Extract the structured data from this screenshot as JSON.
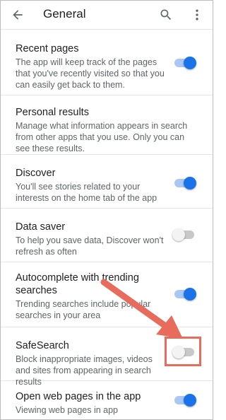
{
  "header": {
    "title": "General",
    "back_icon": "arrow-back-icon",
    "search_icon": "search-icon",
    "more_icon": "more-vert-icon"
  },
  "settings": [
    {
      "label": "Recent pages",
      "description": "The app will keep track of the pages that you've recently visited so that you can easily get back to them.",
      "enabled": true
    },
    {
      "label": "Personal results",
      "description": "Manage what information appears in search from other apps that you use. Only you can see these results."
    },
    {
      "label": "Discover",
      "description": "You'll see stories related to your interests on the home tab of the app",
      "enabled": true
    },
    {
      "label": "Data saver",
      "description": "To help you save data, Discover won't refresh as often",
      "enabled": false
    },
    {
      "label": "Autocomplete with trending searches",
      "description": "Trending searches include popular searches in your area",
      "enabled": true
    },
    {
      "label": "SafeSearch",
      "description": "Block inappropriate images, videos and sites from appearing in search results",
      "enabled": false
    },
    {
      "label": "Open web pages in the app",
      "description": "Viewing web pages in app",
      "enabled": true
    }
  ],
  "annotation": {
    "color": "#e86c5b",
    "target": "SafeSearch toggle"
  },
  "colors": {
    "accent": "#1a73e8",
    "text_primary": "#202124",
    "text_secondary": "#5f6368"
  }
}
